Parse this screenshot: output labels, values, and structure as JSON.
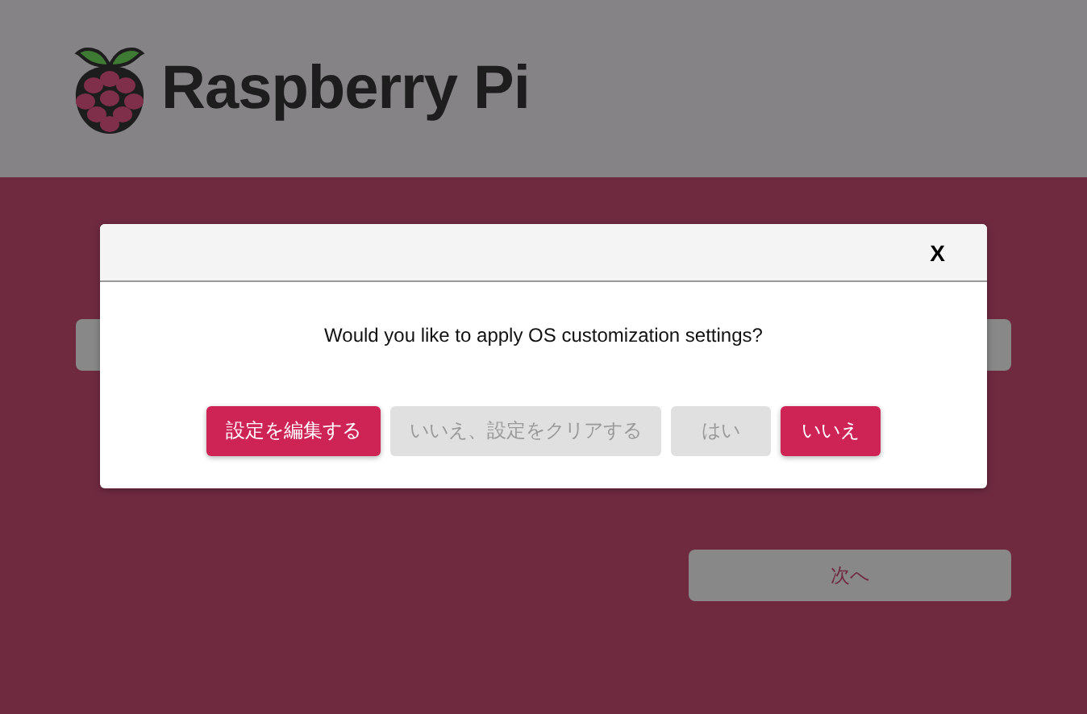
{
  "header": {
    "title": "Raspberry Pi"
  },
  "background": {
    "next_button": "次へ"
  },
  "dialog": {
    "close": "X",
    "message": "Would you like to apply OS customization settings?",
    "buttons": [
      {
        "label": "設定を編集する",
        "disabled": false
      },
      {
        "label": "いいえ、設定をクリアする",
        "disabled": true
      },
      {
        "label": "はい",
        "disabled": true
      },
      {
        "label": "いいえ",
        "disabled": false
      }
    ]
  }
}
